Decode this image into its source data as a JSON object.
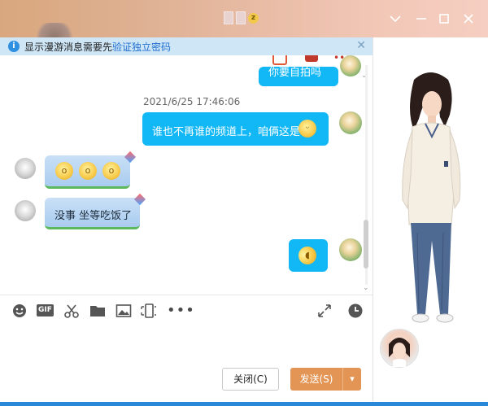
{
  "window": {
    "title_blurred": "▮▮",
    "status_badge": "z"
  },
  "notice": {
    "text": "显示漫游消息需要先",
    "link": "验证独立密码"
  },
  "chat": {
    "top_partial_text": "你要自拍吗",
    "timestamp": "2021/6/25 17:46:06",
    "messages": [
      {
        "from": "me",
        "text": "谁也不再谁的频道上，咱俩这是"
      },
      {
        "from": "them",
        "text": "😫😫😫"
      },
      {
        "from": "them",
        "text": "没事 坐等吃饭了"
      },
      {
        "from": "me",
        "text": ""
      }
    ]
  },
  "toolbar": {
    "gif_label": "GIF",
    "more_label": "•••"
  },
  "buttons": {
    "close_label": "关闭(C)",
    "send_label": "发送(S)",
    "send_dropdown": "▾"
  }
}
